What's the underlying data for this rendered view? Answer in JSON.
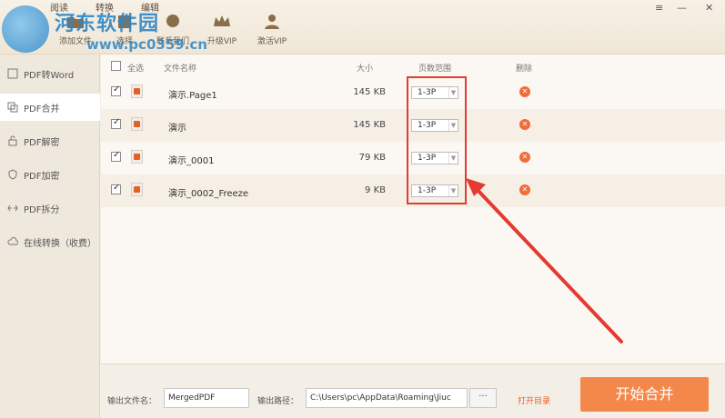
{
  "top_menu": [
    "阅读",
    "转换",
    "编辑"
  ],
  "toolbar": {
    "add_file": "添加文件",
    "select": "选择",
    "contact": "联系我们",
    "upgrade": "升级VIP",
    "activate": "激活VIP"
  },
  "window_controls": {
    "menu": "≡",
    "minimize": "—",
    "close": "✕"
  },
  "watermark": {
    "site_name": "河东软件园",
    "url": "www.pc0359.cn"
  },
  "sidebar": {
    "items": [
      {
        "label": "PDF转Word",
        "icon": "word-doc-icon"
      },
      {
        "label": "PDF合并",
        "icon": "merge-icon"
      },
      {
        "label": "PDF解密",
        "icon": "unlock-icon"
      },
      {
        "label": "PDF加密",
        "icon": "shield-icon"
      },
      {
        "label": "PDF拆分",
        "icon": "split-icon"
      },
      {
        "label": "在线转换（收费）",
        "icon": "cloud-icon"
      }
    ]
  },
  "table": {
    "headers": {
      "select_all": "全选",
      "filename": "文件名称",
      "size": "大小",
      "page_range": "页数范围",
      "delete": "删除"
    },
    "rows": [
      {
        "name": "演示.Page1",
        "size": "145 KB",
        "pages": "1-3P",
        "checked": true
      },
      {
        "name": "演示",
        "size": "145 KB",
        "pages": "1-3P",
        "checked": true
      },
      {
        "name": "演示_0001",
        "size": "79 KB",
        "pages": "1-3P",
        "checked": true
      },
      {
        "name": "演示_0002_Freeze",
        "size": "9 KB",
        "pages": "1-3P",
        "checked": true
      }
    ]
  },
  "footer": {
    "output_name_label": "输出文件名：",
    "output_name_value": "MergedPDF",
    "output_path_label": "输出路径：",
    "output_path_value": "C:\\Users\\pc\\AppData\\Roaming\\Jiuc",
    "browse": "···",
    "open_dir": "打开目录",
    "start": "开始合并"
  },
  "colors": {
    "accent": "#f4884a",
    "highlight": "#e53a32",
    "delete": "#f06c3a"
  }
}
